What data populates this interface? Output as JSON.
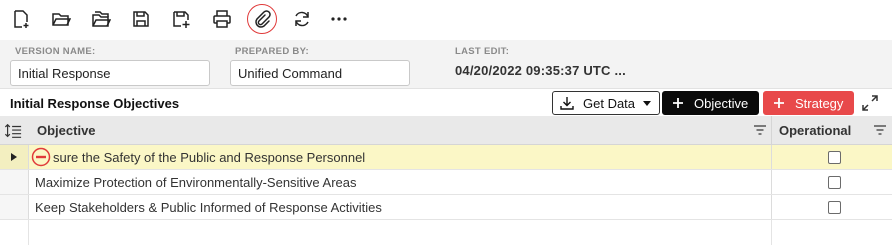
{
  "toolbar": {
    "buttons": [
      {
        "name": "new-document-icon"
      },
      {
        "name": "open-folder-icon"
      },
      {
        "name": "open-multiple-icon"
      },
      {
        "name": "save-icon"
      },
      {
        "name": "save-as-icon"
      },
      {
        "name": "print-icon"
      },
      {
        "name": "paperclip-icon",
        "active": true
      },
      {
        "name": "refresh-icon"
      },
      {
        "name": "more-icon"
      }
    ],
    "active_color": "#e03a3a"
  },
  "info": {
    "version_name_label": "VERSION NAME:",
    "version_name_value": "Initial Response",
    "prepared_by_label": "PREPARED BY:",
    "prepared_by_value": "Unified Command",
    "last_edit_label": "LAST EDIT:",
    "last_edit_value": "04/20/2022 09:35:37 UTC ..."
  },
  "section": {
    "title": "Initial Response Objectives",
    "get_data_label": "Get Data",
    "objective_label": "Objective",
    "strategy_label": "Strategy",
    "strategy_color": "#e8494a"
  },
  "grid": {
    "columns": {
      "objective": "Objective",
      "operational": "Operational"
    },
    "rows": [
      {
        "text": "sure the Safety of the Public and Response Personnel",
        "selected": true,
        "operational": false
      },
      {
        "text": "Maximize Protection of Environmentally-Sensitive Areas",
        "selected": false,
        "operational": false
      },
      {
        "text": "Keep Stakeholders & Public Informed of Response Activities",
        "selected": false,
        "operational": false
      }
    ],
    "selected_row_color": "#fbf7c6"
  }
}
